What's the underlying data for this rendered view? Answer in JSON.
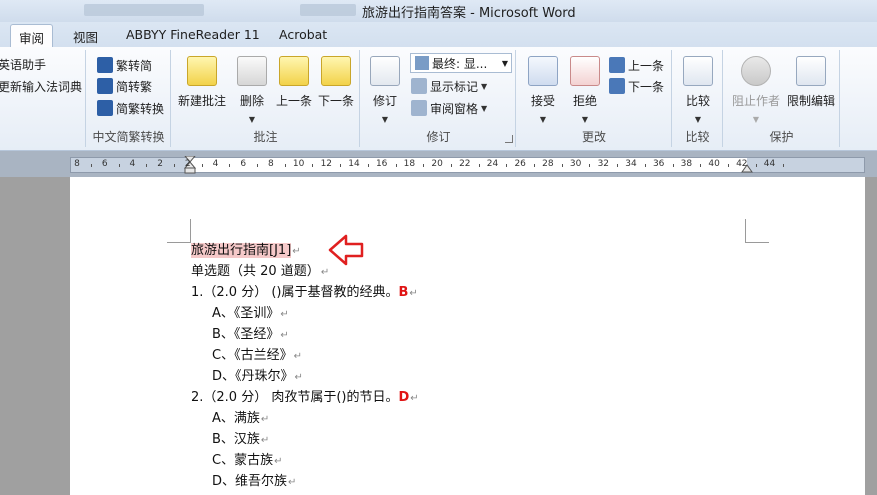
{
  "window": {
    "title": "旅游出行指南答案 - Microsoft Word"
  },
  "tabs": [
    {
      "label": "审阅",
      "active": true
    },
    {
      "label": "视图"
    },
    {
      "label": "ABBYY FineReader 11"
    },
    {
      "label": "Acrobat"
    }
  ],
  "ribbon": {
    "left_partial": {
      "item1": "英语助手",
      "item2": "更新输入法词典"
    },
    "chinese_convert": {
      "label": "中文简繁转换",
      "to_simplified": "繁转简",
      "to_traditional": "简转繁",
      "convert": "简繁转换"
    },
    "comments": {
      "label": "批注",
      "new_comment": "新建批注",
      "delete": "删除",
      "previous": "上一条",
      "next": "下一条"
    },
    "tracking": {
      "label": "修订",
      "track_changes": "修订",
      "display_combo": "最终: 显...",
      "show_markup": "显示标记",
      "reviewing_pane": "审阅窗格"
    },
    "changes": {
      "label": "更改",
      "accept": "接受",
      "reject": "拒绝",
      "previous": "上一条",
      "next": "下一条"
    },
    "compare": {
      "label": "比较",
      "compare": "比较"
    },
    "protect": {
      "label": "保护",
      "block_authors": "阻止作者",
      "restrict_editing": "限制编辑"
    }
  },
  "ruler": {
    "labels": [
      "8",
      "6",
      "4",
      "2",
      "2",
      "4",
      "6",
      "8",
      "10",
      "12",
      "14",
      "16",
      "18",
      "20",
      "22",
      "24",
      "26",
      "28",
      "30",
      "32",
      "34",
      "36",
      "38",
      "40",
      "42",
      "44"
    ]
  },
  "document": {
    "title": "旅游出行指南",
    "comment_ref": "[J1]",
    "section": "单选题（共 20 道题）",
    "questions": [
      {
        "stem": "1.（2.0 分）  ()属于基督教的经典。",
        "answer": "B",
        "options": [
          "A、《圣训》",
          "B、《圣经》",
          "C、《古兰经》",
          "D、《丹珠尔》"
        ]
      },
      {
        "stem": "2.（2.0 分）  肉孜节属于()的节日。",
        "answer": "D",
        "options": [
          "A、满族",
          "B、汉族",
          "C、蒙古族",
          "D、维吾尔族"
        ]
      }
    ]
  },
  "colors": {
    "answer": "#e01515",
    "arrow": "#e02020",
    "highlight": "#f5c9c9"
  }
}
